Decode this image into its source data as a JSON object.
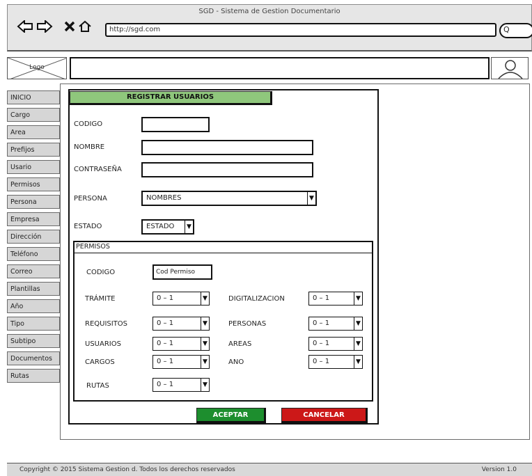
{
  "browser": {
    "title": "SGD - Sistema de Gestion Documentario",
    "url": "http://sgd.com",
    "search_label": "Q"
  },
  "header": {
    "logo_text": "Logo"
  },
  "sidebar": {
    "items": [
      {
        "label": "INICIO"
      },
      {
        "label": "Cargo"
      },
      {
        "label": "Area"
      },
      {
        "label": "Prefijos"
      },
      {
        "label": "Usario"
      },
      {
        "label": "Permisos"
      },
      {
        "label": "Persona"
      },
      {
        "label": "Empresa"
      },
      {
        "label": "Dirección"
      },
      {
        "label": "Teléfono"
      },
      {
        "label": "Correo"
      },
      {
        "label": "Plantillas"
      },
      {
        "label": "Año"
      },
      {
        "label": "Tipo"
      },
      {
        "label": "Subtipo"
      },
      {
        "label": "Documentos"
      },
      {
        "label": "Rutas"
      }
    ]
  },
  "form": {
    "title": "REGISTRAR USUARIOS",
    "codigo_label": "CODIGO",
    "codigo_value": "",
    "nombre_label": "NOMBRE",
    "nombre_value": "",
    "password_label": "CONTRASEÑA",
    "password_value": "",
    "persona_label": "PERSONA",
    "persona_value": "NOMBRES",
    "estado_label": "ESTADO",
    "estado_value": "ESTADO"
  },
  "permisos": {
    "title": "PERMISOS",
    "codigo_label": "CODIGO",
    "codigo_value": "Cod Permiso",
    "fields": {
      "tramite": {
        "label": "TRÁMITE",
        "value": "0 – 1"
      },
      "requisitos": {
        "label": "REQUISITOS",
        "value": "0 – 1"
      },
      "usuarios": {
        "label": "USUARIOS",
        "value": "0 – 1"
      },
      "cargos": {
        "label": "CARGOS",
        "value": "0 – 1"
      },
      "rutas": {
        "label": "RUTAS",
        "value": "0 – 1"
      },
      "digitalizacion": {
        "label": "DIGITALIZACION",
        "value": "0 – 1"
      },
      "personas": {
        "label": "PERSONAS",
        "value": "0 – 1"
      },
      "areas": {
        "label": "AREAS",
        "value": "0 – 1"
      },
      "ano": {
        "label": "ANO",
        "value": "0 – 1"
      }
    }
  },
  "buttons": {
    "accept": "ACEPTAR",
    "cancel": "CANCELAR"
  },
  "footer": {
    "copyright": "Copyright © 2015 Sistema Gestion d. Todos los derechos reservados",
    "version": "Version 1.0"
  },
  "colors": {
    "title_bg": "#8fc77c",
    "accept_bg": "#1d8e2e",
    "cancel_bg": "#cc1818"
  }
}
